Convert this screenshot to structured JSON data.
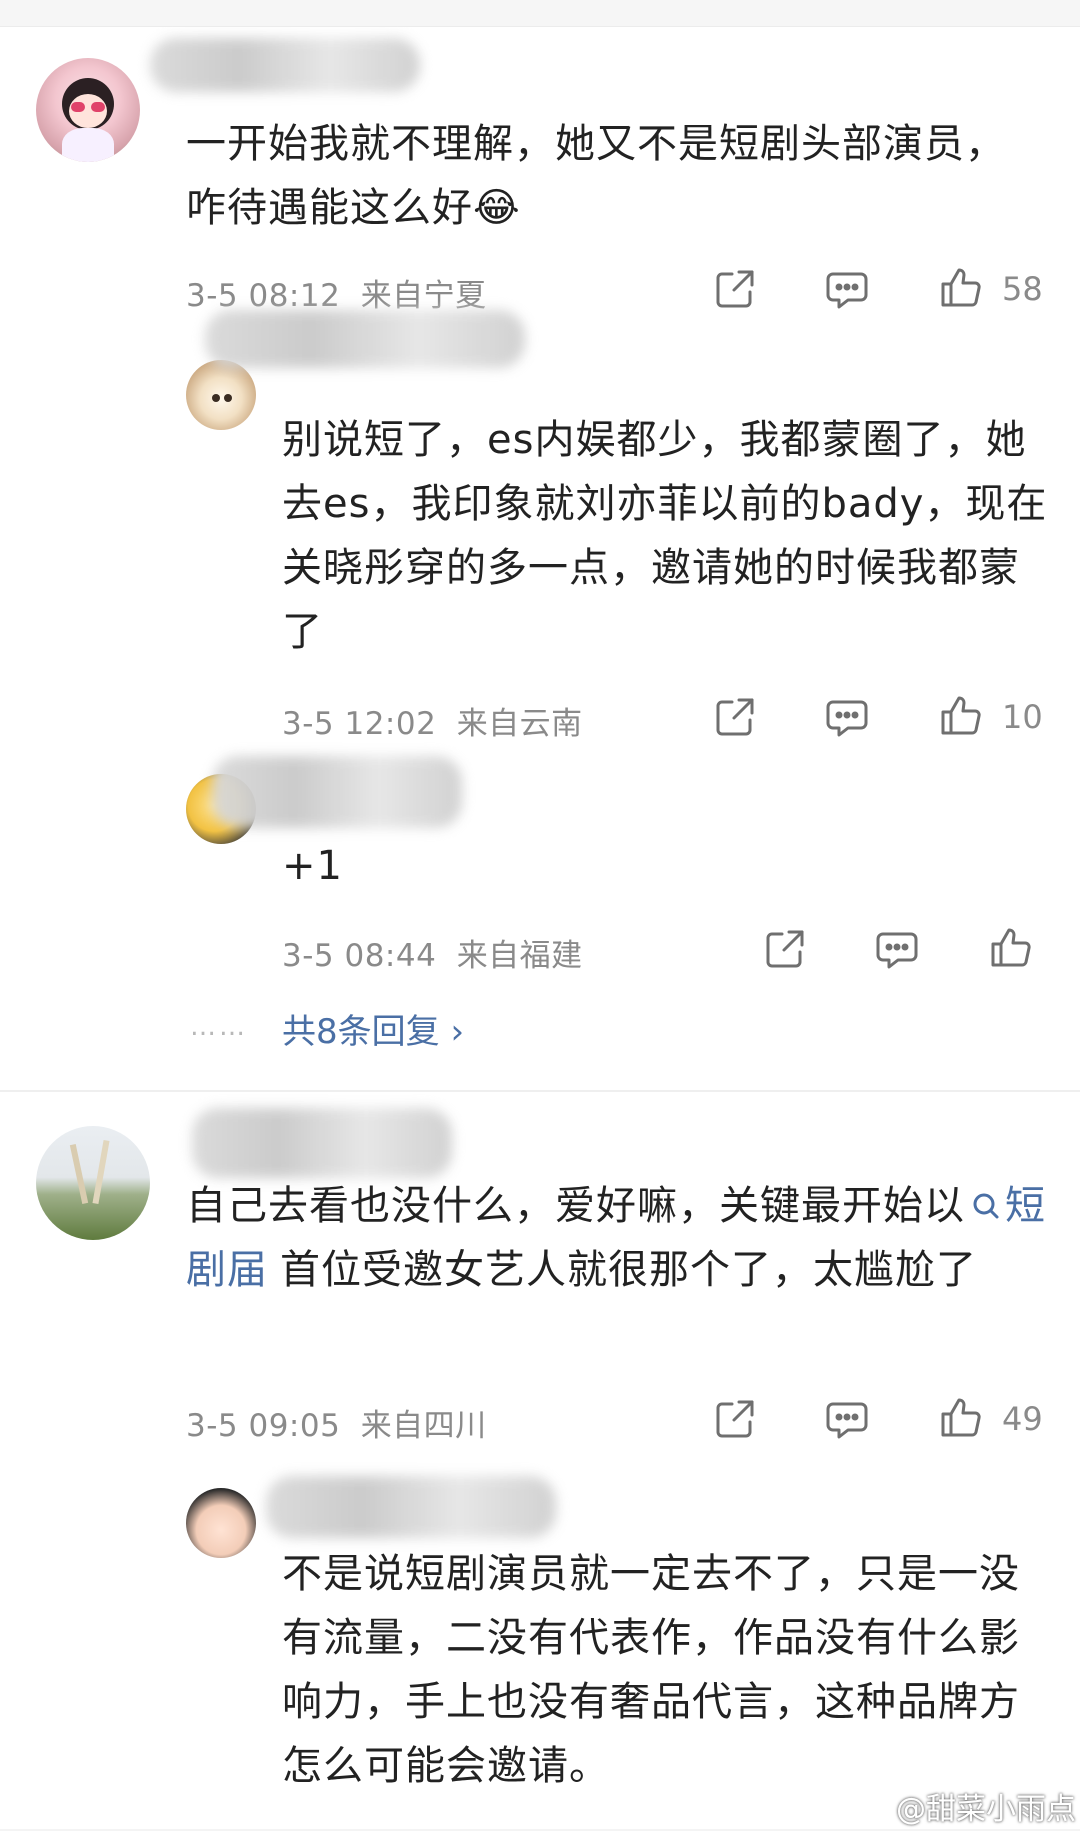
{
  "comments": [
    {
      "text": "一开始我就不理解，她又不是短剧头部演员，咋待遇能这么好😂",
      "time": "3-5 08:12",
      "location": "来自宁夏",
      "likes": "58",
      "replies": [
        {
          "text": "别说短了，es内娱都少，我都蒙圈了，她去es，我印象就刘亦菲以前的bady，现在关晓彤穿的多一点，邀请她的时候我都蒙了",
          "time": "3-5 12:02",
          "location": "来自云南",
          "likes": "10"
        },
        {
          "text": "+1",
          "time": "3-5 08:44",
          "location": "来自福建",
          "likes": ""
        }
      ],
      "more_replies_dots": "……",
      "more_replies_label": "共8条回复 ›"
    },
    {
      "text_before": "自己去看也没什么，爱好嘛，关键最开始以",
      "topic": "短剧届",
      "text_after": "首位受邀女艺人就很那个了，太尴尬了",
      "time": "3-5 09:05",
      "location": "来自四川",
      "likes": "49",
      "replies": [
        {
          "text": "不是说短剧演员就一定去不了，只是一没有流量，二没有代表作，作品没有什么影响力，手上也没有奢品代言，这种品牌方怎么可能会邀请。",
          "time": "",
          "location": "",
          "likes": ""
        }
      ]
    }
  ],
  "watermark": "@甜菜小雨点",
  "colors": {
    "link": "#4a6fa5",
    "meta": "#8a8a8a",
    "text": "#222222"
  },
  "icons": [
    "share-icon",
    "comment-icon",
    "like-icon",
    "search-icon",
    "weibo-logo-icon"
  ]
}
